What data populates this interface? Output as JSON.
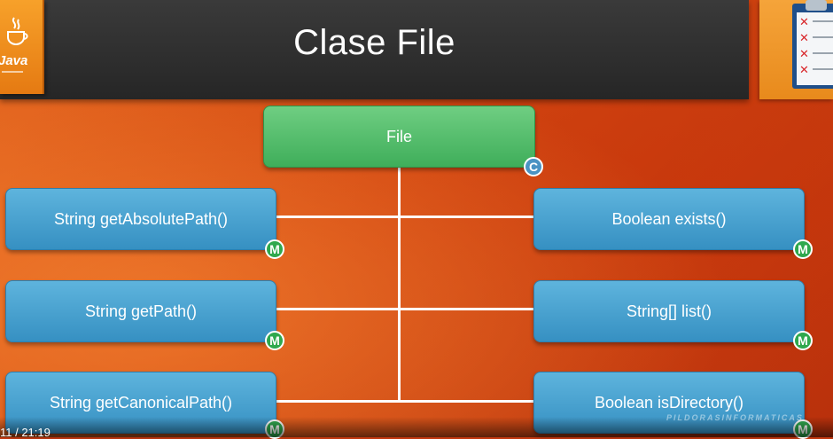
{
  "title": "Clase File",
  "logo": {
    "word": "Java"
  },
  "class_node": {
    "label": "File",
    "badge": "C"
  },
  "methods_left": [
    {
      "label": "String getAbsolutePath()",
      "badge": "M"
    },
    {
      "label": "String getPath()",
      "badge": "M"
    },
    {
      "label": "String getCanonicalPath()",
      "badge": "M"
    }
  ],
  "methods_right": [
    {
      "label": "Boolean exists()",
      "badge": "M"
    },
    {
      "label": "String[] list()",
      "badge": "M"
    },
    {
      "label": "Boolean isDirectory()",
      "badge": "M"
    }
  ],
  "watermark": "PILDORASINFORMATICAS",
  "timestamp": "11 / 21:19",
  "colors": {
    "method_node": "#4aa3d1",
    "class_node": "#52bd6c",
    "method_badge": "#2fa84d",
    "class_badge": "#4a93c3"
  },
  "icons": [
    "java-logo",
    "clipboard-checklist-icon"
  ]
}
